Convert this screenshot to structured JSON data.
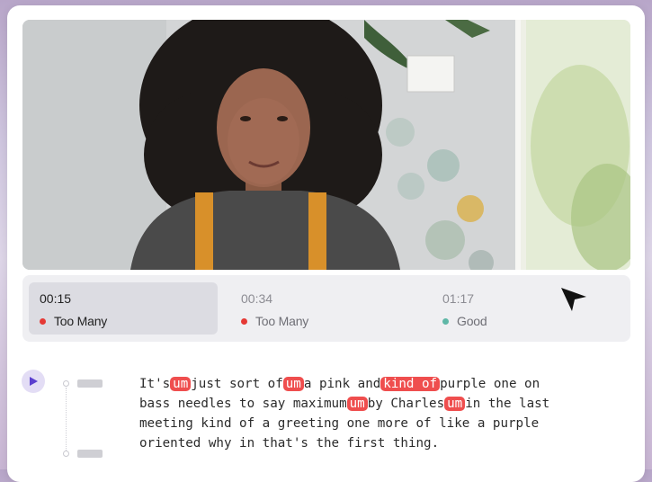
{
  "colors": {
    "too_many": "#e53935",
    "good": "#5fb7a7",
    "highlight": "#ef4e4e",
    "accent": "#6a4fd6"
  },
  "timeline": {
    "segments": [
      {
        "time": "00:15",
        "status": "Too Many",
        "status_color": "#e53935",
        "active": true
      },
      {
        "time": "00:34",
        "status": "Too Many",
        "status_color": "#e53935",
        "active": false
      },
      {
        "time": "01:17",
        "status": "Good",
        "status_color": "#5fb7a7",
        "active": false
      }
    ]
  },
  "transcript": {
    "play_icon": "play-icon",
    "lines": [
      [
        {
          "t": "It's",
          "hl": false
        },
        {
          "t": "um",
          "hl": true
        },
        {
          "t": "just sort of",
          "hl": false
        },
        {
          "t": "um",
          "hl": true
        },
        {
          "t": "a pink and",
          "hl": false
        },
        {
          "t": "kind of",
          "hl": true
        },
        {
          "t": "purple one on",
          "hl": false
        }
      ],
      [
        {
          "t": "bass needles to say maximum",
          "hl": false
        },
        {
          "t": "um",
          "hl": true
        },
        {
          "t": "by Charles",
          "hl": false
        },
        {
          "t": "um",
          "hl": true
        },
        {
          "t": "in the last",
          "hl": false
        }
      ],
      [
        {
          "t": "meeting kind of a greeting one more of like a purple",
          "hl": false
        }
      ],
      [
        {
          "t": "oriented why in that's the first thing.",
          "hl": false
        }
      ]
    ]
  }
}
